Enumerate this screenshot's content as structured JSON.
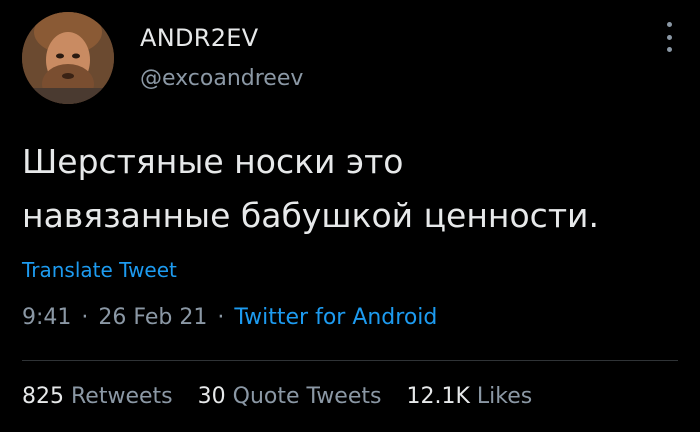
{
  "author": {
    "name": "ANDR2EV",
    "handle": "@excoandreev"
  },
  "tweet": {
    "line1": "Шерстяные носки это",
    "line2": "навязанные бабушкой ценности."
  },
  "translate_label": "Translate Tweet",
  "meta": {
    "time": "9:41",
    "separator": "·",
    "date": "26 Feb 21",
    "source": "Twitter for Android"
  },
  "stats": {
    "retweets_count": "825",
    "retweets_label": "Retweets",
    "quotes_count": "30",
    "quotes_label": "Quote Tweets",
    "likes_count": "12.1K",
    "likes_label": "Likes"
  },
  "colors": {
    "background": "#000000",
    "text": "#e7e9ea",
    "muted": "#8b98a5",
    "link": "#1d9bf0"
  },
  "icons": {
    "more": "more-vertical-icon"
  }
}
